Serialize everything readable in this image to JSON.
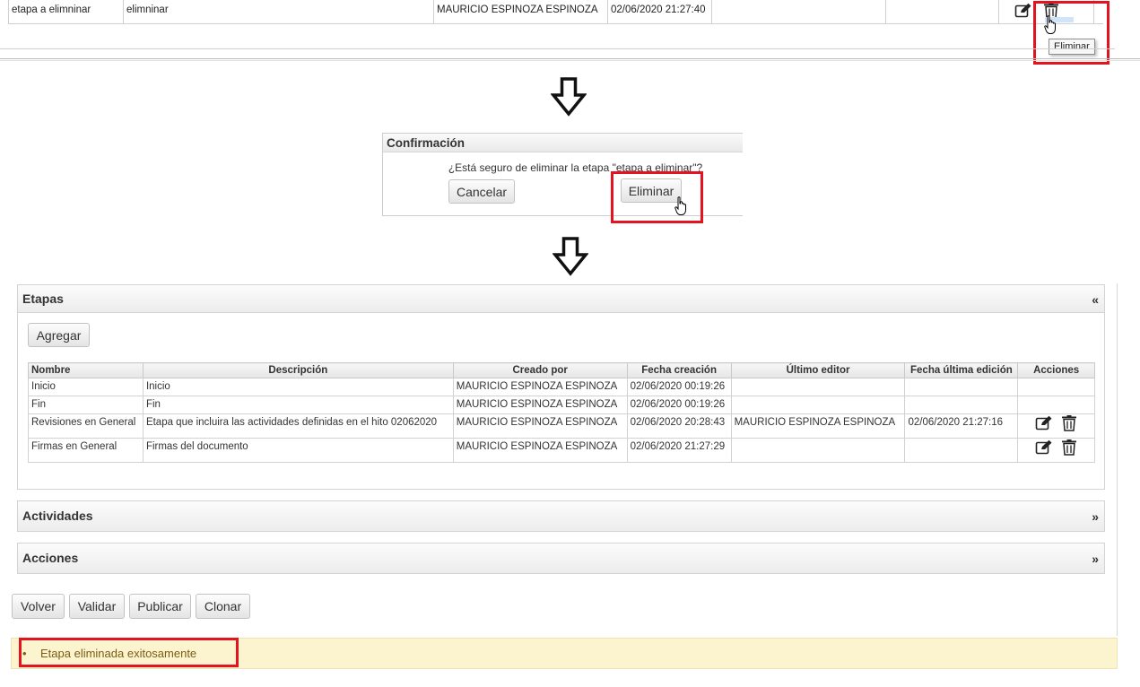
{
  "top_row": {
    "cells": [
      "etapa a elimninar",
      "elimninar",
      "",
      "MAURICIO ESPINOZA ESPINOZA",
      "02/06/2020 21:27:40",
      "",
      ""
    ],
    "tooltip": "Eliminar"
  },
  "dialog": {
    "title": "Confirmación",
    "message": "¿Está seguro de eliminar la etapa \"etapa a eliminar\"?",
    "cancel_label": "Cancelar",
    "confirm_label": "Eliminar"
  },
  "etapas": {
    "title": "Etapas",
    "toggle": "«",
    "add_label": "Agregar",
    "columns": [
      "Nombre",
      "Descripción",
      "Creado por",
      "Fecha creación",
      "Último editor",
      "Fecha última edición",
      "Acciones"
    ],
    "rows": [
      {
        "nombre": "Inicio",
        "descripcion": "Inicio",
        "creado_por": "MAURICIO ESPINOZA ESPINOZA",
        "fecha_creacion": "02/06/2020 00:19:26",
        "ultimo_editor": "",
        "fecha_edicion": "",
        "has_actions": false
      },
      {
        "nombre": "Fin",
        "descripcion": "Fin",
        "creado_por": "MAURICIO ESPINOZA ESPINOZA",
        "fecha_creacion": "02/06/2020 00:19:26",
        "ultimo_editor": "",
        "fecha_edicion": "",
        "has_actions": false
      },
      {
        "nombre": "Revisiones en General",
        "descripcion": "Etapa que incluira las actividades definidas en el hito 02062020",
        "creado_por": "MAURICIO ESPINOZA ESPINOZA",
        "fecha_creacion": "02/06/2020 20:28:43",
        "ultimo_editor": "MAURICIO ESPINOZA ESPINOZA",
        "fecha_edicion": "02/06/2020 21:27:16",
        "has_actions": true
      },
      {
        "nombre": "Firmas en General",
        "descripcion": "Firmas del documento",
        "creado_por": "MAURICIO ESPINOZA ESPINOZA",
        "fecha_creacion": "02/06/2020 21:27:29",
        "ultimo_editor": "",
        "fecha_edicion": "",
        "has_actions": true
      }
    ]
  },
  "actividades": {
    "title": "Actividades",
    "toggle": "»"
  },
  "acciones": {
    "title": "Acciones",
    "toggle": "»"
  },
  "footer_buttons": [
    "Volver",
    "Validar",
    "Publicar",
    "Clonar"
  ],
  "notice": {
    "bullet": "•",
    "text": "Etapa eliminada exitosamente"
  },
  "colors": {
    "highlight_border": "#e3141f",
    "notice_bg": "#fcf3cf"
  },
  "icons": {
    "edit": "edit-icon",
    "delete": "trash-icon",
    "cursor": "hand-pointer-icon",
    "arrow": "down-arrow-icon"
  }
}
